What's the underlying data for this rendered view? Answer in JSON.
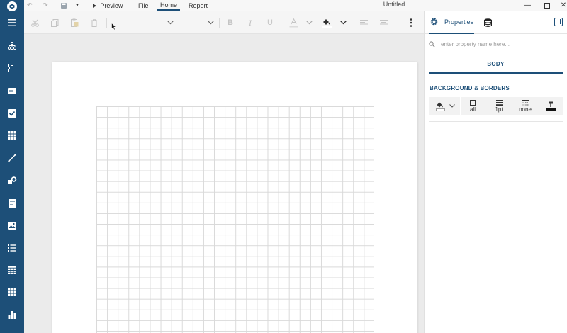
{
  "titlebar": {
    "preview_label": "Preview",
    "menu_tabs": [
      "File",
      "Home",
      "Report"
    ],
    "window_title": "Untitled"
  },
  "sidebar": {
    "items": [
      "hamburger-menu",
      "data-tree",
      "layout",
      "textbox",
      "checkbox",
      "table",
      "line",
      "shapes",
      "richtext",
      "image",
      "list",
      "table-grid",
      "matrix",
      "chart"
    ]
  },
  "panel": {
    "tabs": {
      "properties_label": "Properties"
    },
    "search": {
      "placeholder": "enter property name here..."
    },
    "body_label": "BODY",
    "section_title": "BACKGROUND & BORDERS",
    "border": {
      "sides": "all",
      "width": "1pt",
      "style": "none"
    }
  },
  "colors": {
    "sidebar": "#1d4f78",
    "accent": "#1d4f78",
    "canvas_bg": "#ebebeb",
    "page": "#ffffff",
    "grid_line": "#d9d9d9"
  }
}
